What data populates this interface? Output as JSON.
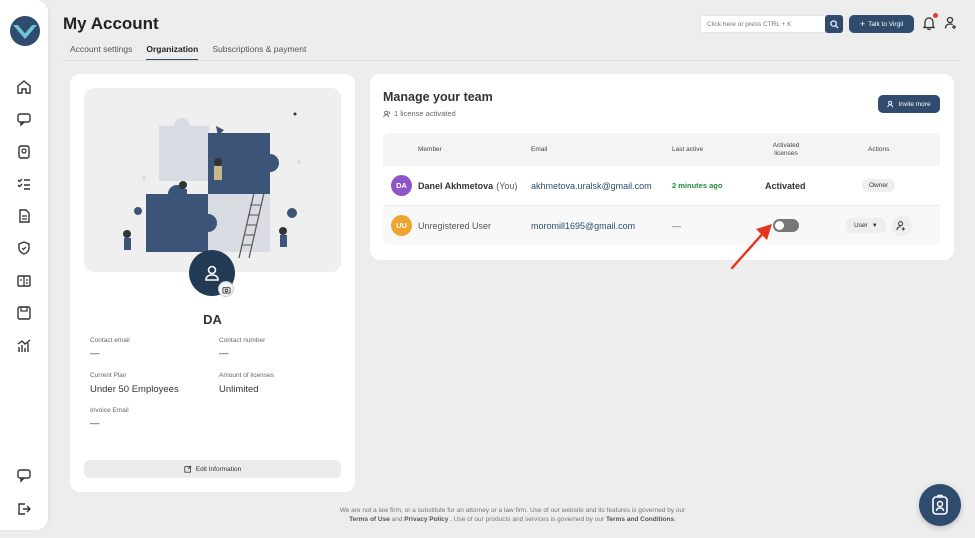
{
  "header": {
    "title": "My Account",
    "tabs": [
      {
        "label": "Account settings",
        "active": false
      },
      {
        "label": "Organization",
        "active": true
      },
      {
        "label": "Subscriptions & payment",
        "active": false
      }
    ],
    "search_placeholder": "Click here or press CTRL + K",
    "talk_button": "Talk to Virgil",
    "notification_dot_color": "#e23b3b"
  },
  "sidebar": {
    "items": [
      "home-icon",
      "chat-icon",
      "badge-icon",
      "checklist-icon",
      "document-icon",
      "shield-icon",
      "compare-icon",
      "save-icon",
      "analytics-icon"
    ],
    "bottom_items": [
      "messages-icon",
      "logout-icon"
    ]
  },
  "profile": {
    "initials": "DA",
    "contact_email_label": "Contact email",
    "contact_email_value": "—",
    "contact_number_label": "Contact number",
    "contact_number_value": "—",
    "plan_label": "Current Plan",
    "plan_value": "Under 50 Employees",
    "licenses_label": "Amount of licenses",
    "licenses_value": "Unlimited",
    "invoice_label": "Invoice Email",
    "invoice_value": "—",
    "edit_button": "Edit Information"
  },
  "team": {
    "title": "Manage your team",
    "license_text": "1 license activated",
    "invite_button": "Invite more",
    "columns": {
      "member": "Member",
      "email": "Email",
      "last_active": "Last active",
      "activated": "Activated licenses",
      "actions": "Actions"
    },
    "rows": [
      {
        "initials": "DA",
        "avatar_color": "#8e55c9",
        "name": "Danel Akhmetova",
        "suffix": "(You)",
        "email": "akhmetova.uralsk@gmail.com",
        "last_active": "2 minutes ago",
        "activated": "Activated",
        "action": "Owner"
      },
      {
        "initials": "UU",
        "avatar_color": "#f0a430",
        "name": "Unregistered User",
        "suffix": "",
        "email": "moromill1695@gmail.com",
        "last_active": "—",
        "activated_toggle": false,
        "action": "User"
      }
    ]
  },
  "footer": {
    "line1": "We are not a law firm, or a substitute for an attorney or a law firm. Use of our website and its features is governed by our",
    "terms_of_use": "Terms of Use",
    "and": "and",
    "privacy": "Privacy Policy",
    "line2_mid": ". Use of our products and services is governed by our",
    "terms_conditions": "Terms and Conditions",
    "end": "."
  },
  "colors": {
    "primary": "#2f4b6e",
    "accent_green": "#1e8a3a",
    "arrow_red": "#e5341f"
  }
}
